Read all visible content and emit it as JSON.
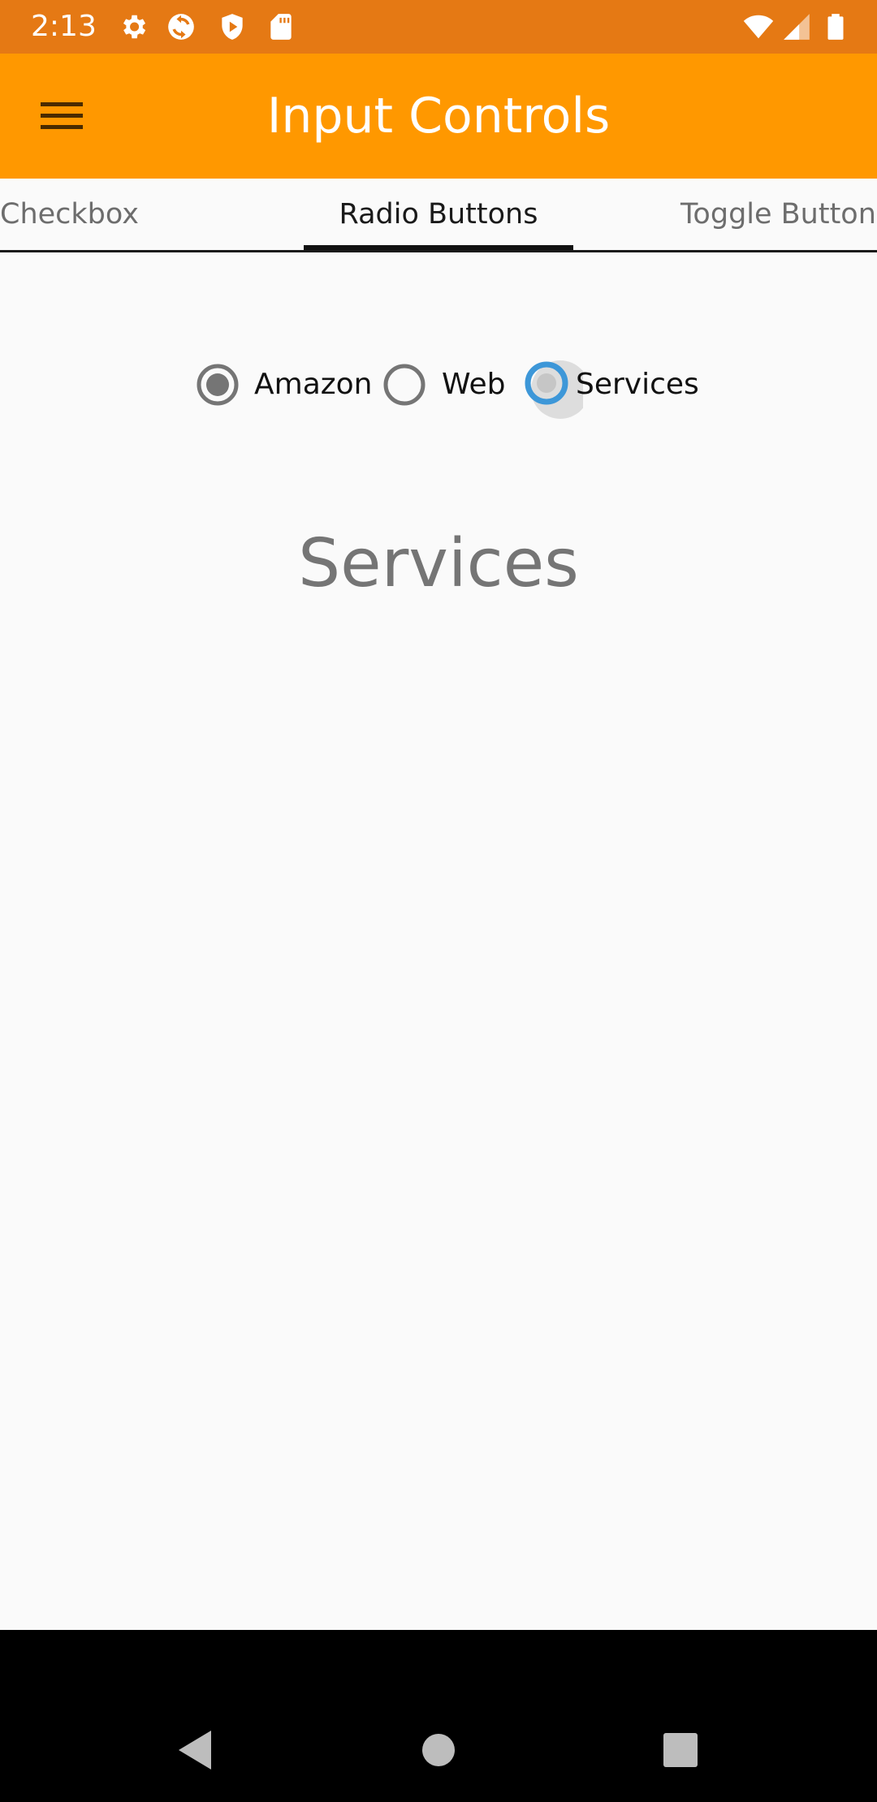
{
  "status_bar": {
    "time": "2:13",
    "left_icons": [
      "settings-icon",
      "sync-icon",
      "play-protect-icon",
      "sd-card-icon"
    ],
    "right_icons": [
      "wifi-icon",
      "cell-signal-icon",
      "battery-icon"
    ]
  },
  "app_bar": {
    "title": "Input Controls",
    "menu_icon": "hamburger-menu-icon",
    "color": "#ff9800"
  },
  "tabs": [
    {
      "label": "Checkbox",
      "selected": false
    },
    {
      "label": "Radio Buttons",
      "selected": true
    },
    {
      "label": "Toggle Button",
      "selected": false
    }
  ],
  "radio_group": {
    "options": [
      {
        "label": "Amazon",
        "state": "checked-gray"
      },
      {
        "label": "Web",
        "state": "unchecked"
      },
      {
        "label": "Services",
        "state": "checked-blue"
      }
    ],
    "accent_color": "#3d97d8"
  },
  "selection_text": "Services",
  "nav_bar": {
    "buttons": [
      "back-icon",
      "home-icon",
      "recents-icon"
    ]
  }
}
